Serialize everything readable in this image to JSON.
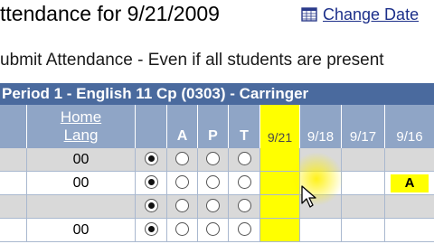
{
  "header": {
    "title": "ttendance for 9/21/2009",
    "change_date": {
      "label": "Change Date",
      "icon": "calendar-icon"
    }
  },
  "notice": "ubmit Attendance - Even if all students are present",
  "period": {
    "title": "Period 1 - English 11 Cp (0303) - Carringer"
  },
  "columns": {
    "home_lang": [
      "Home",
      "Lang"
    ],
    "a": "A",
    "p": "P",
    "t": "T",
    "today": "9/21",
    "dates": [
      "9/18",
      "9/17",
      "9/16"
    ]
  },
  "rows": [
    {
      "lang": "00",
      "selected": "present-default",
      "history": [
        "",
        "",
        ""
      ]
    },
    {
      "lang": "00",
      "selected": "present-default",
      "history": [
        "",
        "",
        "A"
      ]
    },
    {
      "lang": "",
      "selected": "present-default",
      "history": [
        "",
        "",
        ""
      ]
    },
    {
      "lang": "00",
      "selected": "present-default",
      "history": [
        "",
        "",
        ""
      ]
    }
  ],
  "colors": {
    "period_bar": "#4a6a9e",
    "header": "#8fa5c6",
    "today_highlight": "#ffff00",
    "row_alt": "#d9d9d9"
  }
}
